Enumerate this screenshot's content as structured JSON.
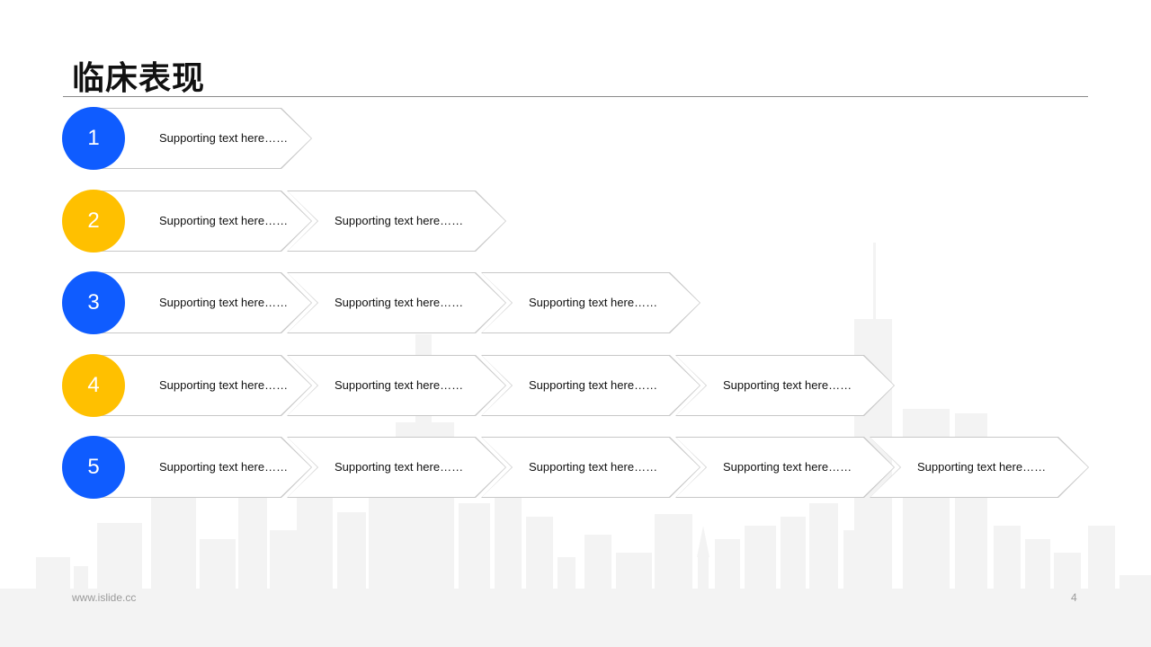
{
  "slide": {
    "title": "临床表现",
    "footer_url": "www.islide.cc",
    "page_number": "4"
  },
  "colors": {
    "blue": "#0f5cff",
    "yellow": "#ffc000",
    "title": "#111111",
    "chevron_border": "#c8c8c8",
    "skyline": "#f2f2f2"
  },
  "rows": [
    {
      "number": "1",
      "color": "#0f5cff",
      "items": [
        "Supporting text here……"
      ]
    },
    {
      "number": "2",
      "color": "#ffc000",
      "items": [
        "Supporting text here……",
        "Supporting text here……"
      ]
    },
    {
      "number": "3",
      "color": "#0f5cff",
      "items": [
        "Supporting text here……",
        "Supporting text here……",
        "Supporting text here……"
      ]
    },
    {
      "number": "4",
      "color": "#ffc000",
      "items": [
        "Supporting text here……",
        "Supporting text here……",
        "Supporting text here……",
        "Supporting text here……"
      ]
    },
    {
      "number": "5",
      "color": "#0f5cff",
      "items": [
        "Supporting text here……",
        "Supporting text here……",
        "Supporting text here……",
        "Supporting text here……",
        "Supporting text here……"
      ]
    }
  ]
}
